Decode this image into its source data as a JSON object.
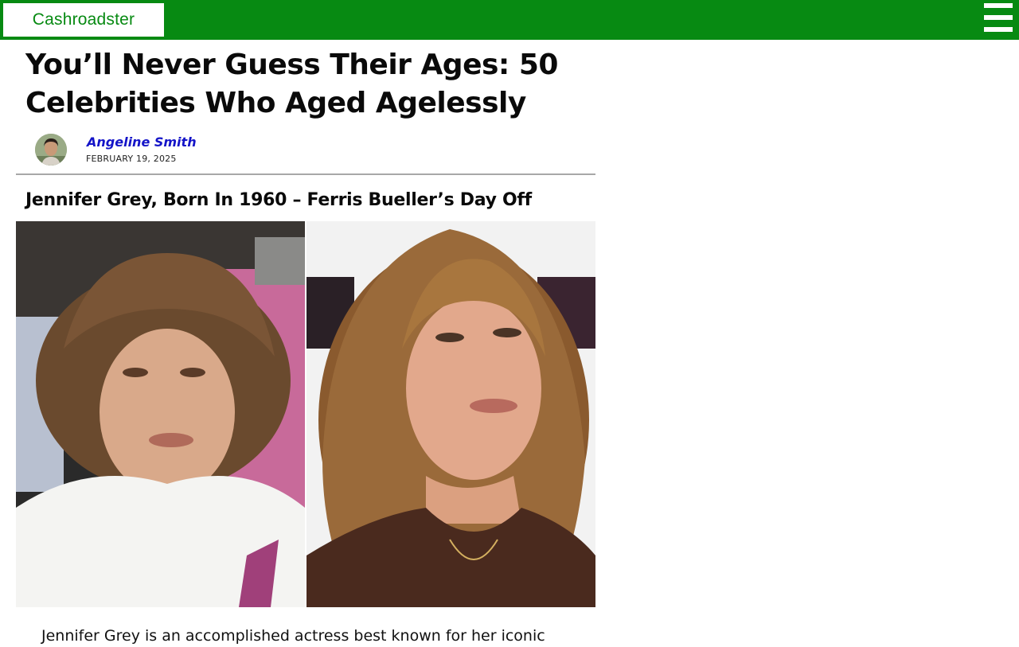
{
  "header": {
    "logo": "Cashroadster",
    "menu_icon": "hamburger-menu-icon",
    "brand_color": "#078a12"
  },
  "article": {
    "title": "You’ll Never Guess Their Ages: 50 Celebrities Who Aged Agelessly",
    "author": "Angeline Smith",
    "date": "FEBRUARY 19, 2025",
    "section_title": "Jennifer Grey, Born In 1960 – Ferris Bueller’s Day Off",
    "body_text": "Jennifer Grey is an accomplished actress best known for her iconic"
  },
  "colors": {
    "author_link": "#1414c8",
    "divider": "#a8a8a8"
  }
}
